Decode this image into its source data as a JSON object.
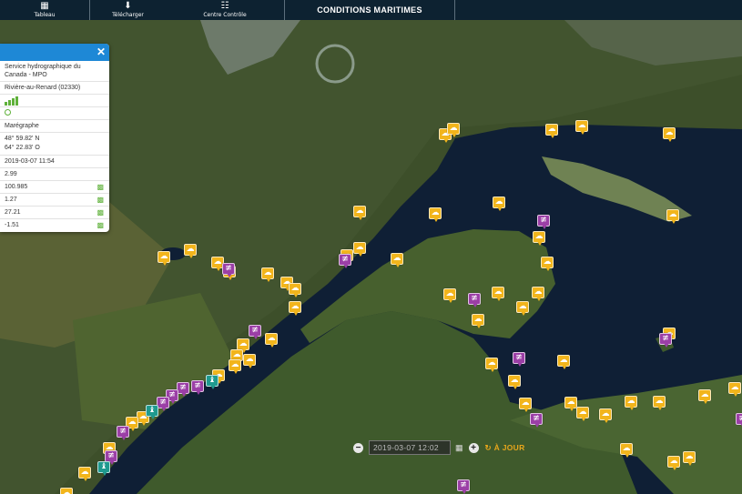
{
  "topbar": {
    "items": [
      {
        "label": "Tableau",
        "icon": "table-icon"
      },
      {
        "label": "Télécharger",
        "icon": "download-icon"
      },
      {
        "label": "Centre Contrôle",
        "icon": "grid-icon"
      }
    ],
    "title": "CONDITIONS MARITIMES"
  },
  "panel": {
    "provider": "Service hydrographique du Canada - MPO",
    "station": "Rivière-au-Renard (02330)",
    "type": "Marégraphe",
    "lat": "48° 59.82' N",
    "lon": "64° 22.83' O",
    "datetime": "2019-03-07 11:54",
    "values": [
      "2.99",
      "100.985",
      "1.27",
      "27.21",
      "-1.51"
    ]
  },
  "timebar": {
    "date": "2019-03-07 12:02",
    "today_label": "À JOUR"
  },
  "colors": {
    "weather": "#f2b51c",
    "tide": "#9b3fa6",
    "buoy": "#1f9a8f",
    "panel_header": "#1e88d6"
  }
}
